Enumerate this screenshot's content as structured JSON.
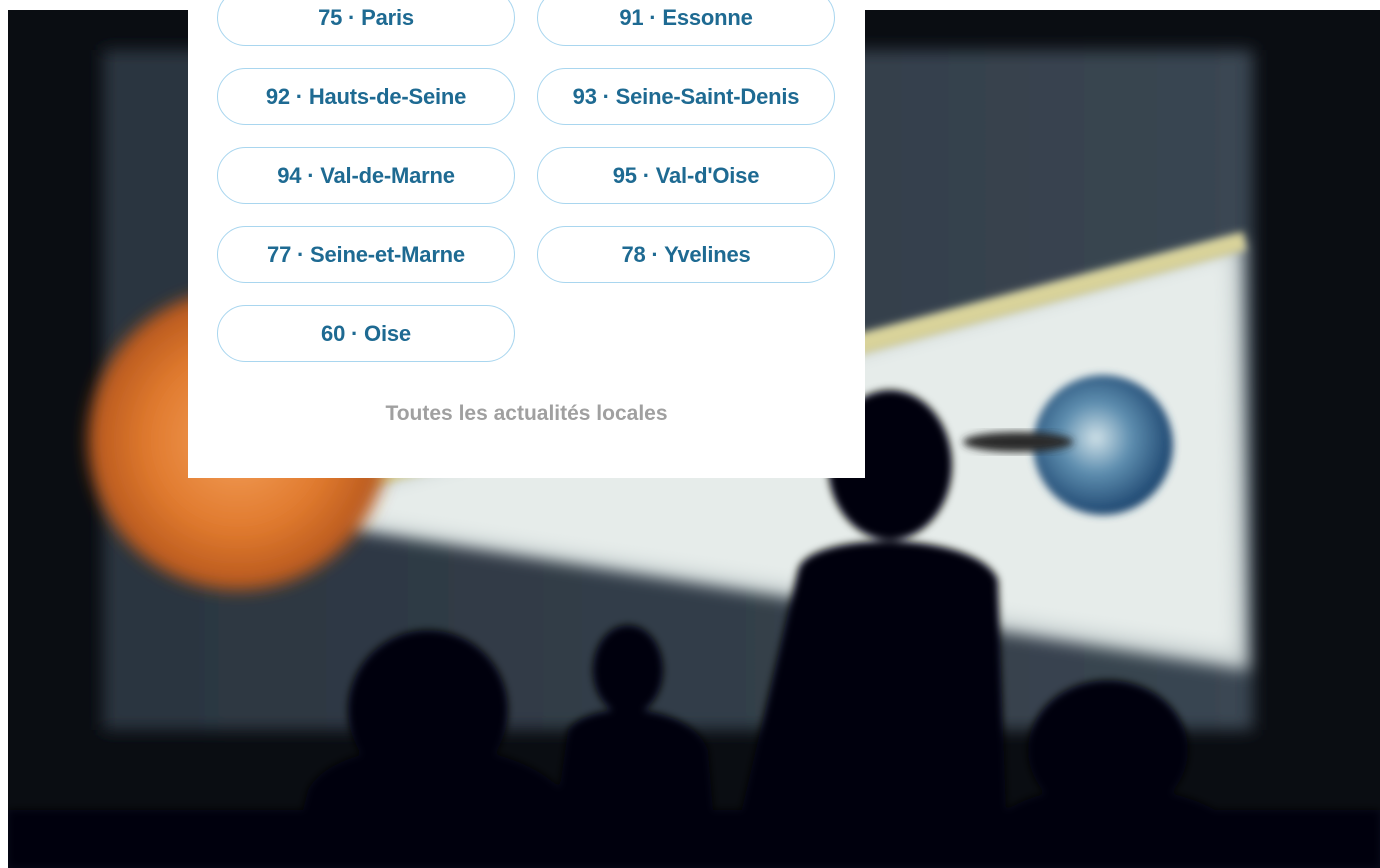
{
  "departments": [
    {
      "label": "75 · Paris"
    },
    {
      "label": "91 · Essonne"
    },
    {
      "label": "92 · Hauts-de-Seine"
    },
    {
      "label": "93 · Seine-Saint-Denis"
    },
    {
      "label": "94 · Val-de-Marne"
    },
    {
      "label": "95 · Val-d'Oise"
    },
    {
      "label": "77 · Seine-et-Marne"
    },
    {
      "label": "78 · Yvelines"
    },
    {
      "label": "60 · Oise"
    }
  ],
  "all_local_news_link": "Toutes les actualités locales",
  "colors": {
    "pill_border": "#a9d6ef",
    "pill_text": "#1e6a92",
    "link_text": "#a0a0a0",
    "panel_bg": "#ffffff"
  }
}
